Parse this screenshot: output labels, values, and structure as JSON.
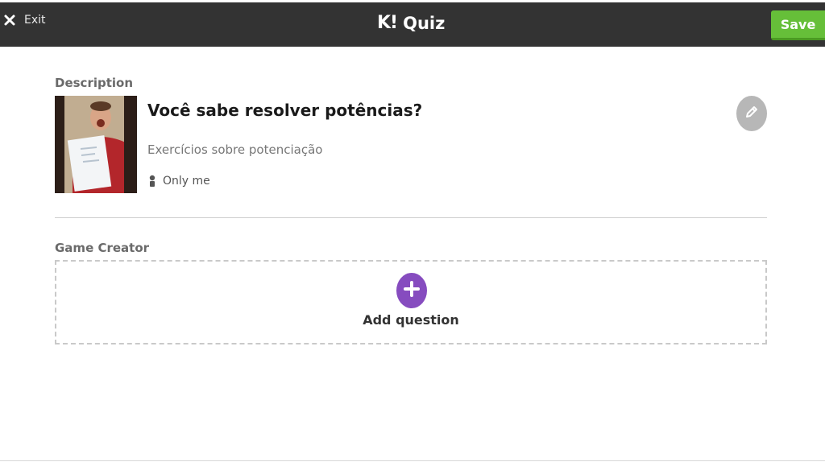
{
  "header": {
    "exit_label": "Exit",
    "brand_logo": "K!",
    "title": "Quiz",
    "save_label": "Save"
  },
  "description": {
    "heading": "Description",
    "quiz_title": "Você sabe resolver potências?",
    "quiz_description": "Exercícios sobre potenciação",
    "visibility": "Only me"
  },
  "game_creator": {
    "heading": "Game Creator",
    "add_question_label": "Add question"
  },
  "icons": {
    "exit": "close-icon",
    "visibility": "person-icon",
    "edit": "pencil-icon",
    "add": "plus-icon"
  },
  "colors": {
    "topbar": "#333333",
    "save": "#66bf39",
    "add": "#864cbf",
    "edit": "#b7b7b7"
  }
}
